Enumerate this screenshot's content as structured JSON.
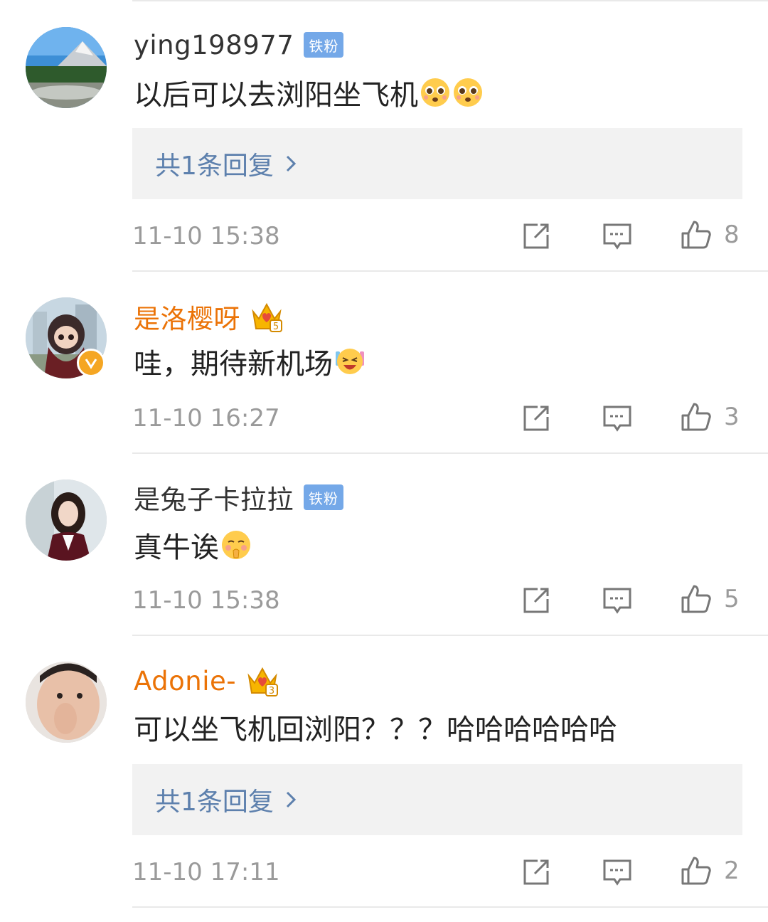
{
  "comments": [
    {
      "username": "ying198977",
      "badge": "铁粉",
      "badge_type": "fan",
      "text": "以后可以去浏阳坐飞机",
      "emojis": [
        "pleading-face",
        "pleading-face"
      ],
      "reply_label": "共1条回复",
      "timestamp": "11-10 15:38",
      "likes": "8"
    },
    {
      "username": "是洛樱呀",
      "badge_type": "crown",
      "badge_level": "5",
      "verified": true,
      "text": "哇，期待新机场",
      "emojis": [
        "excited-face"
      ],
      "timestamp": "11-10 16:27",
      "likes": "3"
    },
    {
      "username": "是兔子卡拉拉",
      "badge": "铁粉",
      "badge_type": "fan",
      "text": "真牛诶",
      "emojis": [
        "shy-face"
      ],
      "timestamp": "11-10 15:38",
      "likes": "5"
    },
    {
      "username": "Adonie-",
      "badge_type": "crown",
      "badge_level": "3",
      "text": "可以坐飞机回浏阳？？？哈哈哈哈哈哈",
      "emojis": [],
      "reply_label": "共1条回复",
      "timestamp": "11-10 17:11",
      "likes": "2"
    }
  ],
  "colors": {
    "vip_name": "#eb7307",
    "normal_name": "#333333",
    "reply_link": "#5d80ad",
    "fan_badge": "#74a8e8",
    "meta": "#9a9a9a"
  }
}
